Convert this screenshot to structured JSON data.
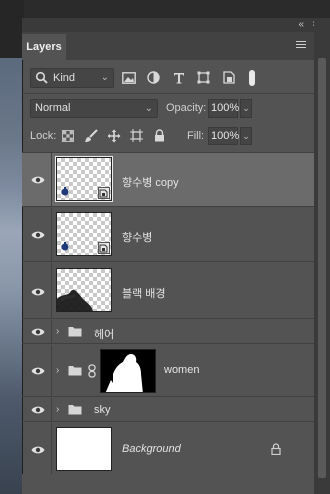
{
  "panel": {
    "tab_label": "Layers",
    "collapse_glyph": "«",
    "close_glyph": "×"
  },
  "filter": {
    "kind_label": "Kind",
    "icons": [
      "image-filter-icon",
      "adjustment-filter-icon",
      "type-filter-icon",
      "shape-filter-icon",
      "smart-object-filter-icon",
      "filter-toggle"
    ]
  },
  "blend": {
    "mode": "Normal",
    "opacity_label": "Opacity:",
    "opacity_value": "100%"
  },
  "lock": {
    "label": "Lock:",
    "icons": [
      "lock-transparent-pixels-icon",
      "lock-image-pixels-icon",
      "lock-position-icon",
      "lock-artboard-icon",
      "lock-all-icon"
    ],
    "fill_label": "Fill:",
    "fill_value": "100%"
  },
  "layers": [
    {
      "name": "향수병 copy",
      "type": "smart-object",
      "selected": true,
      "visible": true
    },
    {
      "name": "향수병",
      "type": "smart-object",
      "selected": false,
      "visible": true
    },
    {
      "name": "블랙 배경",
      "type": "pixel",
      "selected": false,
      "visible": true
    },
    {
      "name": "헤어",
      "type": "group",
      "selected": false,
      "visible": true
    },
    {
      "name": "women",
      "type": "group-with-mask",
      "selected": false,
      "visible": true
    },
    {
      "name": "sky",
      "type": "group",
      "selected": false,
      "visible": true
    },
    {
      "name": "Background",
      "type": "background",
      "selected": false,
      "visible": true,
      "locked": true
    }
  ],
  "colors": {
    "panel_bg": "#535353",
    "selected_row": "#6b6b6b",
    "bottle_blue": "#1e3a78"
  }
}
